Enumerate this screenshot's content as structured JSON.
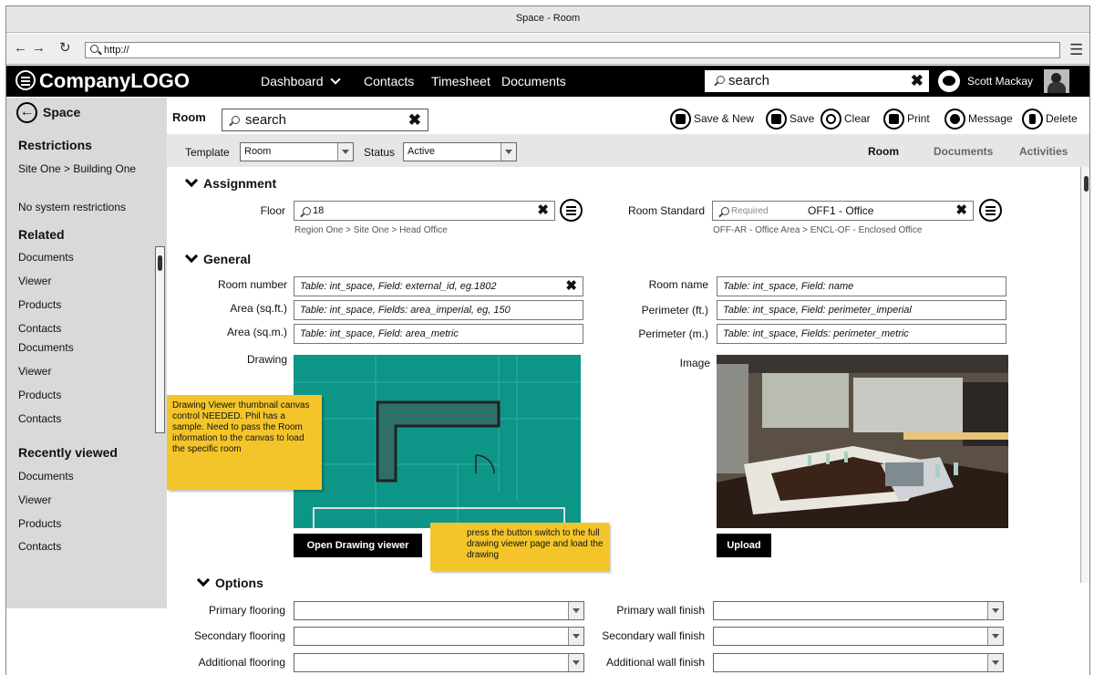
{
  "window": {
    "title": "Space - Room"
  },
  "browser": {
    "url": "http://"
  },
  "topnav": {
    "logo": "CompanyLOGO",
    "dashboard": "Dashboard",
    "contacts": "Contacts",
    "timesheet": "Timesheet",
    "documents": "Documents",
    "search": "search",
    "user": "Scott Mackay"
  },
  "sidebar": {
    "title": "Space",
    "restrictions_heading": "Restrictions",
    "location": "Site One > Building One",
    "restrictions_note": "No system restrictions",
    "related_heading": "Related",
    "related": [
      "Documents",
      "Viewer",
      "Products",
      "Contacts",
      "Documents",
      "Viewer",
      "Products",
      "Contacts"
    ],
    "recent_heading": "Recently viewed",
    "recent": [
      "Documents",
      "Viewer",
      "Products",
      "Contacts"
    ]
  },
  "header": {
    "label": "Room",
    "search": "search",
    "save_new": "Save & New",
    "save": "Save",
    "clear": "Clear",
    "print": "Print",
    "message": "Message",
    "delete": "Delete"
  },
  "template_bar": {
    "template_label": "Template",
    "template_value": "Room",
    "status_label": "Status",
    "status_value": "Active",
    "tabs": [
      "Room",
      "Documents",
      "Activities"
    ]
  },
  "assignment": {
    "heading": "Assignment",
    "floor_label": "Floor",
    "floor_value": "18",
    "floor_path": "Region One > Site One > Head Office",
    "standard_label": "Room Standard",
    "standard_placeholder": "Required",
    "standard_value": "OFF1 - Office",
    "standard_path": "OFF-AR - Office Area > ENCL-OF - Enclosed Office"
  },
  "general": {
    "heading": "General",
    "room_number_label": "Room number",
    "room_number": "Table: int_space, Field: external_id, eg.1802",
    "area_sqft_label": "Area (sq.ft.)",
    "area_sqft": "Table: int_space, Fields: area_imperial, eg, 150",
    "area_sqm_label": "Area (sq.m.)",
    "area_sqm": "Table: int_space, Field: area_metric",
    "room_name_label": "Room name",
    "room_name": "Table: int_space, Field: name",
    "perim_ft_label": "Perimeter (ft.)",
    "perim_ft": "Table: int_space, Field: perimeter_imperial",
    "perim_m_label": "Perimeter (m.)",
    "perim_m": "Table: int_space, Fields: perimeter_metric",
    "drawing_label": "Drawing",
    "image_label": "Image",
    "open_drawing": "Open Drawing viewer",
    "upload": "Upload"
  },
  "notes": {
    "drawing_note": "Drawing Viewer thumbnail canvas control NEEDED. Phil has a sample. Need to pass the Room information to the canvas to load the specific room",
    "button_note": "press the button switch to the full drawing viewer page and load the drawing"
  },
  "options": {
    "heading": "Options",
    "primary_flooring": "Primary flooring",
    "secondary_flooring": "Secondary flooring",
    "additional_flooring": "Additional flooring",
    "primary_wall": "Primary wall finish",
    "secondary_wall": "Secondary wall finish",
    "additional_wall": "Additional wall finish"
  },
  "colors": {
    "drawing_bg": "#0d9688",
    "note_bg": "#f3c52a",
    "nav_bg": "#000000",
    "panel_bg": "#d9d9d9"
  }
}
